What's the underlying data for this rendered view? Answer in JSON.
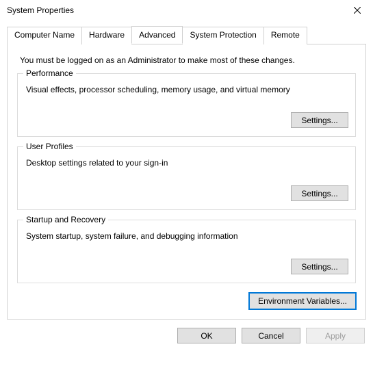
{
  "window": {
    "title": "System Properties"
  },
  "tabs": [
    {
      "label": "Computer Name"
    },
    {
      "label": "Hardware"
    },
    {
      "label": "Advanced"
    },
    {
      "label": "System Protection"
    },
    {
      "label": "Remote"
    }
  ],
  "intro": "You must be logged on as an Administrator to make most of these changes.",
  "groups": {
    "performance": {
      "title": "Performance",
      "desc": "Visual effects, processor scheduling, memory usage, and virtual memory",
      "button": "Settings..."
    },
    "userProfiles": {
      "title": "User Profiles",
      "desc": "Desktop settings related to your sign-in",
      "button": "Settings..."
    },
    "startup": {
      "title": "Startup and Recovery",
      "desc": "System startup, system failure, and debugging information",
      "button": "Settings..."
    }
  },
  "envButton": "Environment Variables...",
  "dialogButtons": {
    "ok": "OK",
    "cancel": "Cancel",
    "apply": "Apply"
  }
}
